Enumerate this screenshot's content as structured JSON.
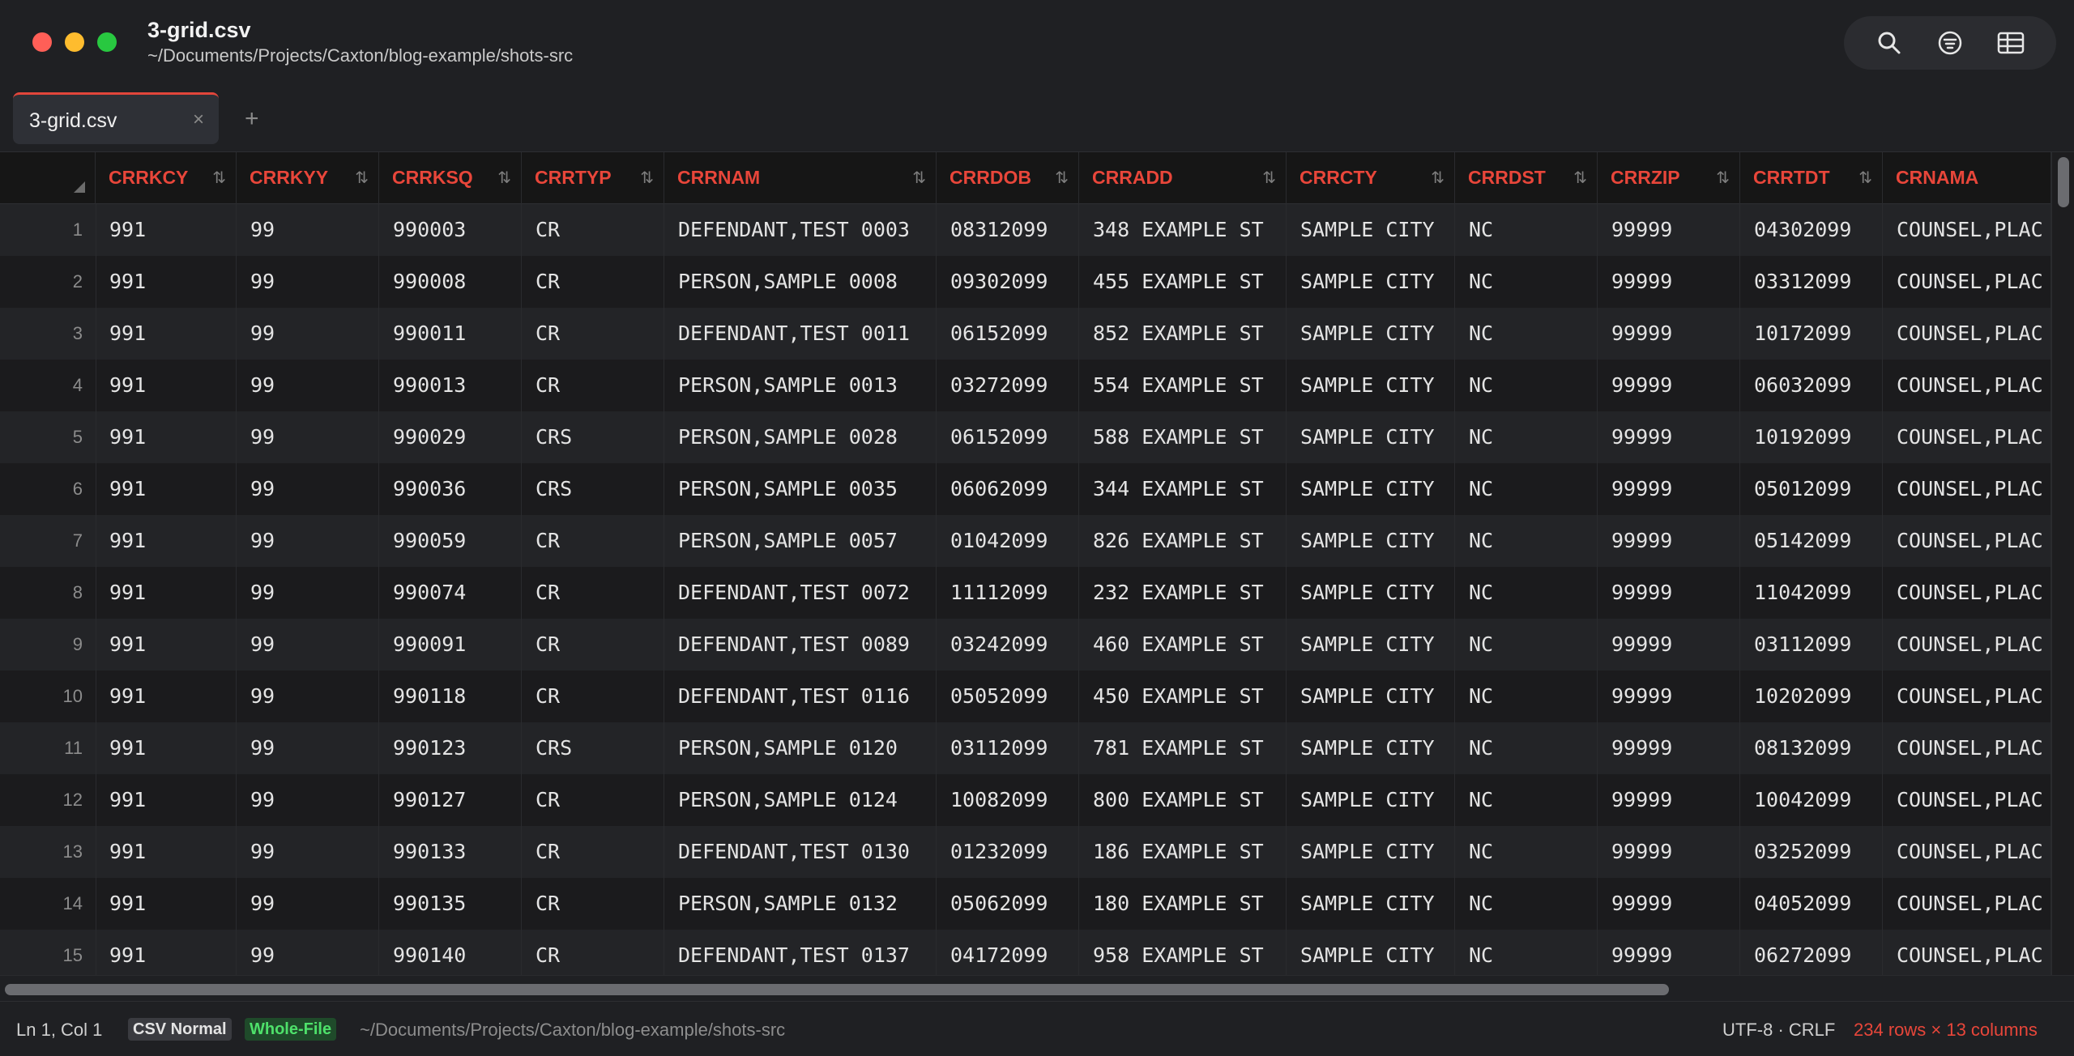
{
  "window": {
    "title": "3-grid.csv",
    "path": "~/Documents/Projects/Caxton/blog-example/shots-src",
    "toolbar_icons": [
      "search-icon",
      "filter-icon",
      "table-icon"
    ]
  },
  "tabs": [
    {
      "label": "3-grid.csv",
      "close": "×",
      "active": true
    }
  ],
  "tab_add": "+",
  "colors": {
    "accent": "#e8463a",
    "mode_badge": "#3a3b40",
    "scope_badge": "#4ee06a"
  },
  "grid": {
    "columns": [
      {
        "label": "CRRKCY",
        "sort": "⇅"
      },
      {
        "label": "CRRKYY",
        "sort": "⇅"
      },
      {
        "label": "CRRKSQ",
        "sort": "⇅"
      },
      {
        "label": "CRRTYP",
        "sort": "⇅"
      },
      {
        "label": "CRRNAM",
        "sort": "⇅"
      },
      {
        "label": "CRRDOB",
        "sort": "⇅"
      },
      {
        "label": "CRRADD",
        "sort": "⇅"
      },
      {
        "label": "CRRCTY",
        "sort": "⇅"
      },
      {
        "label": "CRRDST",
        "sort": "⇅"
      },
      {
        "label": "CRRZIP",
        "sort": "⇅"
      },
      {
        "label": "CRRTDT",
        "sort": "⇅"
      },
      {
        "label": "CRNAMA",
        "sort": ""
      }
    ],
    "rows": [
      {
        "num": "1",
        "cells": [
          "991",
          "99",
          "990003",
          "CR",
          "DEFENDANT,TEST 0003",
          "08312099",
          "348 EXAMPLE ST",
          "SAMPLE CITY",
          "NC",
          "99999",
          "04302099",
          "COUNSEL,PLAC"
        ]
      },
      {
        "num": "2",
        "cells": [
          "991",
          "99",
          "990008",
          "CR",
          "PERSON,SAMPLE 0008",
          "09302099",
          "455 EXAMPLE ST",
          "SAMPLE CITY",
          "NC",
          "99999",
          "03312099",
          "COUNSEL,PLAC"
        ]
      },
      {
        "num": "3",
        "cells": [
          "991",
          "99",
          "990011",
          "CR",
          "DEFENDANT,TEST 0011",
          "06152099",
          "852 EXAMPLE ST",
          "SAMPLE CITY",
          "NC",
          "99999",
          "10172099",
          "COUNSEL,PLAC"
        ]
      },
      {
        "num": "4",
        "cells": [
          "991",
          "99",
          "990013",
          "CR",
          "PERSON,SAMPLE 0013",
          "03272099",
          "554 EXAMPLE ST",
          "SAMPLE CITY",
          "NC",
          "99999",
          "06032099",
          "COUNSEL,PLAC"
        ]
      },
      {
        "num": "5",
        "cells": [
          "991",
          "99",
          "990029",
          "CRS",
          "PERSON,SAMPLE 0028",
          "06152099",
          "588 EXAMPLE ST",
          "SAMPLE CITY",
          "NC",
          "99999",
          "10192099",
          "COUNSEL,PLAC"
        ]
      },
      {
        "num": "6",
        "cells": [
          "991",
          "99",
          "990036",
          "CRS",
          "PERSON,SAMPLE 0035",
          "06062099",
          "344 EXAMPLE ST",
          "SAMPLE CITY",
          "NC",
          "99999",
          "05012099",
          "COUNSEL,PLAC"
        ]
      },
      {
        "num": "7",
        "cells": [
          "991",
          "99",
          "990059",
          "CR",
          "PERSON,SAMPLE 0057",
          "01042099",
          "826 EXAMPLE ST",
          "SAMPLE CITY",
          "NC",
          "99999",
          "05142099",
          "COUNSEL,PLAC"
        ]
      },
      {
        "num": "8",
        "cells": [
          "991",
          "99",
          "990074",
          "CR",
          "DEFENDANT,TEST 0072",
          "11112099",
          "232 EXAMPLE ST",
          "SAMPLE CITY",
          "NC",
          "99999",
          "11042099",
          "COUNSEL,PLAC"
        ]
      },
      {
        "num": "9",
        "cells": [
          "991",
          "99",
          "990091",
          "CR",
          "DEFENDANT,TEST 0089",
          "03242099",
          "460 EXAMPLE ST",
          "SAMPLE CITY",
          "NC",
          "99999",
          "03112099",
          "COUNSEL,PLAC"
        ]
      },
      {
        "num": "10",
        "cells": [
          "991",
          "99",
          "990118",
          "CR",
          "DEFENDANT,TEST 0116",
          "05052099",
          "450 EXAMPLE ST",
          "SAMPLE CITY",
          "NC",
          "99999",
          "10202099",
          "COUNSEL,PLAC"
        ]
      },
      {
        "num": "11",
        "cells": [
          "991",
          "99",
          "990123",
          "CRS",
          "PERSON,SAMPLE 0120",
          "03112099",
          "781 EXAMPLE ST",
          "SAMPLE CITY",
          "NC",
          "99999",
          "08132099",
          "COUNSEL,PLAC"
        ]
      },
      {
        "num": "12",
        "cells": [
          "991",
          "99",
          "990127",
          "CR",
          "PERSON,SAMPLE 0124",
          "10082099",
          "800 EXAMPLE ST",
          "SAMPLE CITY",
          "NC",
          "99999",
          "10042099",
          "COUNSEL,PLAC"
        ]
      },
      {
        "num": "13",
        "cells": [
          "991",
          "99",
          "990133",
          "CR",
          "DEFENDANT,TEST 0130",
          "01232099",
          "186 EXAMPLE ST",
          "SAMPLE CITY",
          "NC",
          "99999",
          "03252099",
          "COUNSEL,PLAC"
        ]
      },
      {
        "num": "14",
        "cells": [
          "991",
          "99",
          "990135",
          "CR",
          "PERSON,SAMPLE 0132",
          "05062099",
          "180 EXAMPLE ST",
          "SAMPLE CITY",
          "NC",
          "99999",
          "04052099",
          "COUNSEL,PLAC"
        ]
      },
      {
        "num": "15",
        "cells": [
          "991",
          "99",
          "990140",
          "CR",
          "DEFENDANT,TEST 0137",
          "04172099",
          "958 EXAMPLE ST",
          "SAMPLE CITY",
          "NC",
          "99999",
          "06272099",
          "COUNSEL,PLAC"
        ]
      }
    ]
  },
  "status": {
    "position": "Ln 1, Col 1",
    "mode": "CSV Normal",
    "scope": "Whole-File",
    "path": "~/Documents/Projects/Caxton/blog-example/shots-src",
    "encoding": "UTF-8 · CRLF",
    "dimensions": "234 rows × 13 columns"
  }
}
